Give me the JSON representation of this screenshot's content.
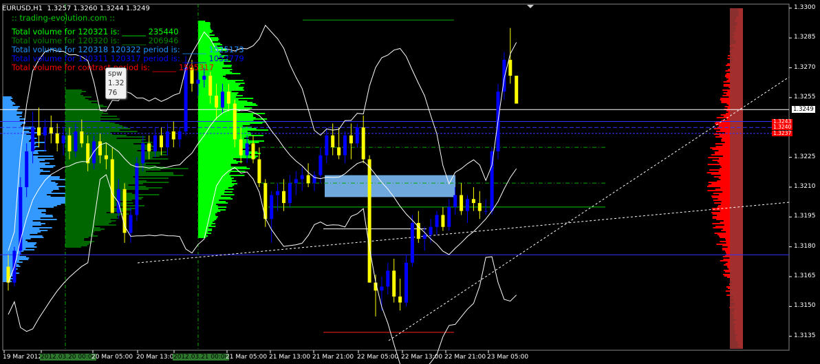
{
  "header": {
    "symbol": "EURUSD,H1",
    "ohlc": "1.3257 1.3260 1.3244 1.3249"
  },
  "site": ":: trading-evolution.com ::",
  "volume_lines": [
    {
      "text": "Total volume for 120321 is: ______ 235440",
      "color": "#00ff00"
    },
    {
      "text": "Total volume for 120320 is: ______ 206946",
      "color": "#008800"
    },
    {
      "text": "Total volume for 120318 120322 period is: ______ 1525173",
      "color": "#1e90ff"
    },
    {
      "text": "Total volume for 120311 120317 period is: ______ 1052779",
      "color": "#0000ff"
    },
    {
      "text": "Total volume for contract period is: ______ 1505317",
      "color": "#ff0000"
    }
  ],
  "tooltip": {
    "line1": "spw",
    "line2": "1.32",
    "line3": "76"
  },
  "price_axis": {
    "labels": [
      "1.3300",
      "1.3285",
      "1.3270",
      "1.3255",
      "1.3225",
      "1.3210",
      "1.3195",
      "1.3180",
      "1.3165",
      "1.3150",
      "1.3135"
    ],
    "values": [
      1.33,
      1.3285,
      1.327,
      1.3255,
      1.3225,
      1.321,
      1.3195,
      1.318,
      1.3165,
      1.315,
      1.3135
    ],
    "current_price": "1.3249",
    "current_value": 1.3249,
    "level_tags": [
      {
        "text": "1.3243",
        "value": 1.3243
      },
      {
        "text": "1.3240",
        "value": 1.324
      },
      {
        "text": "1.3237",
        "value": 1.3237
      }
    ]
  },
  "time_axis": {
    "labels": [
      {
        "text": "19 Mar 2012",
        "hl": false
      },
      {
        "text": "2012.03.20 00:00",
        "hl": true
      },
      {
        "text": "20 Mar 05:00",
        "hl": false
      },
      {
        "text": "20 Mar 13:00",
        "hl": false
      },
      {
        "text": "2012.03.21 00:00",
        "hl": true
      },
      {
        "text": "21 Mar 05:00",
        "hl": false
      },
      {
        "text": "21 Mar 13:00",
        "hl": false
      },
      {
        "text": "21 Mar 21:00",
        "hl": false
      },
      {
        "text": "22 Mar 05:00",
        "hl": false
      },
      {
        "text": "22 Mar 13:00",
        "hl": false
      },
      {
        "text": "22 Mar 21:00",
        "hl": false
      },
      {
        "text": "23 Mar 05:00",
        "hl": false
      }
    ]
  },
  "colors": {
    "bull": "#0000ff",
    "bear": "#ffff00",
    "bollinger": "#ffffff",
    "profile_green": "#00ff00",
    "profile_darkgreen": "#006600",
    "profile_lightblue": "#3399ff",
    "profile_red": "#ff0000",
    "profile_maroon": "#993333",
    "rect": "#6fa8dc"
  },
  "chart_data": {
    "type": "candlestick",
    "symbol": "EURUSD",
    "timeframe": "H1",
    "ylim": [
      1.3128,
      1.3302
    ],
    "candles": [
      [
        1.317,
        1.3176,
        1.3158,
        1.3162
      ],
      [
        1.3162,
        1.318,
        1.316,
        1.3178
      ],
      [
        1.3178,
        1.3215,
        1.3176,
        1.321
      ],
      [
        1.321,
        1.3232,
        1.3205,
        1.3228
      ],
      [
        1.3228,
        1.3248,
        1.3222,
        1.324
      ],
      [
        1.324,
        1.325,
        1.323,
        1.3236
      ],
      [
        1.3236,
        1.3244,
        1.3228,
        1.324
      ],
      [
        1.324,
        1.3246,
        1.3232,
        1.3237
      ],
      [
        1.3237,
        1.3242,
        1.3228,
        1.3232
      ],
      [
        1.3232,
        1.324,
        1.3226,
        1.3236
      ],
      [
        1.3236,
        1.324,
        1.3224,
        1.3228
      ],
      [
        1.3228,
        1.3242,
        1.3225,
        1.3238
      ],
      [
        1.3238,
        1.3244,
        1.323,
        1.3232
      ],
      [
        1.3232,
        1.3236,
        1.3218,
        1.3222
      ],
      [
        1.3222,
        1.3236,
        1.3219,
        1.3233
      ],
      [
        1.3233,
        1.3237,
        1.3222,
        1.3226
      ],
      [
        1.3226,
        1.3232,
        1.3219,
        1.3224
      ],
      [
        1.3224,
        1.323,
        1.32,
        1.3197
      ],
      [
        1.3197,
        1.3214,
        1.3194,
        1.3209
      ],
      [
        1.3209,
        1.3212,
        1.3182,
        1.3187
      ],
      [
        1.3187,
        1.32,
        1.3182,
        1.3196
      ],
      [
        1.3196,
        1.3225,
        1.3193,
        1.3222
      ],
      [
        1.3222,
        1.3236,
        1.3218,
        1.3232
      ],
      [
        1.3232,
        1.3236,
        1.3224,
        1.3228
      ],
      [
        1.3228,
        1.324,
        1.3225,
        1.3236
      ],
      [
        1.3236,
        1.324,
        1.3226,
        1.323
      ],
      [
        1.323,
        1.3242,
        1.3226,
        1.3238
      ],
      [
        1.3238,
        1.3243,
        1.323,
        1.3234
      ],
      [
        1.3234,
        1.324,
        1.323,
        1.3238
      ],
      [
        1.3238,
        1.3276,
        1.3236,
        1.327
      ],
      [
        1.327,
        1.3274,
        1.3258,
        1.3262
      ],
      [
        1.3262,
        1.3268,
        1.3256,
        1.3264
      ],
      [
        1.3264,
        1.327,
        1.326,
        1.3266
      ],
      [
        1.3266,
        1.3268,
        1.3252,
        1.3256
      ],
      [
        1.3256,
        1.3262,
        1.3244,
        1.325
      ],
      [
        1.325,
        1.3262,
        1.3247,
        1.3258
      ],
      [
        1.3258,
        1.3262,
        1.3248,
        1.3252
      ],
      [
        1.3252,
        1.3254,
        1.323,
        1.3234
      ],
      [
        1.3234,
        1.324,
        1.3222,
        1.3226
      ],
      [
        1.3226,
        1.3236,
        1.3222,
        1.3232
      ],
      [
        1.3232,
        1.3236,
        1.3222,
        1.3224
      ],
      [
        1.3224,
        1.323,
        1.321,
        1.3212
      ],
      [
        1.3212,
        1.3214,
        1.319,
        1.3194
      ],
      [
        1.3194,
        1.3208,
        1.3182,
        1.3206
      ],
      [
        1.3206,
        1.3212,
        1.3198,
        1.3208
      ],
      [
        1.3208,
        1.3214,
        1.3198,
        1.3202
      ],
      [
        1.3202,
        1.3216,
        1.32,
        1.3212
      ],
      [
        1.3212,
        1.3218,
        1.3206,
        1.3214
      ],
      [
        1.3214,
        1.322,
        1.3208,
        1.3216
      ],
      [
        1.3216,
        1.3222,
        1.321,
        1.3212
      ],
      [
        1.3212,
        1.3218,
        1.3208,
        1.3216
      ],
      [
        1.3216,
        1.323,
        1.3212,
        1.3226
      ],
      [
        1.3226,
        1.324,
        1.3222,
        1.3236
      ],
      [
        1.3236,
        1.3242,
        1.3226,
        1.323
      ],
      [
        1.323,
        1.324,
        1.3224,
        1.3226
      ],
      [
        1.3226,
        1.3238,
        1.3222,
        1.3236
      ],
      [
        1.3236,
        1.3242,
        1.3224,
        1.3232
      ],
      [
        1.3232,
        1.3242,
        1.323,
        1.324
      ],
      [
        1.324,
        1.3246,
        1.3222,
        1.3224
      ],
      [
        1.3224,
        1.3226,
        1.3172,
        1.3162
      ],
      [
        1.3162,
        1.3166,
        1.3145,
        1.3158
      ],
      [
        1.3158,
        1.3165,
        1.3148,
        1.316
      ],
      [
        1.316,
        1.3172,
        1.3156,
        1.3168
      ],
      [
        1.3168,
        1.3174,
        1.3152,
        1.3155
      ],
      [
        1.3155,
        1.3164,
        1.3148,
        1.3152
      ],
      [
        1.3152,
        1.3176,
        1.315,
        1.3172
      ],
      [
        1.3172,
        1.3196,
        1.317,
        1.3192
      ],
      [
        1.3192,
        1.3198,
        1.3182,
        1.3184
      ],
      [
        1.3184,
        1.319,
        1.3178,
        1.3186
      ],
      [
        1.3186,
        1.3194,
        1.3182,
        1.319
      ],
      [
        1.319,
        1.3198,
        1.3186,
        1.3196
      ],
      [
        1.3196,
        1.32,
        1.3188,
        1.319
      ],
      [
        1.319,
        1.3204,
        1.3188,
        1.32
      ],
      [
        1.32,
        1.321,
        1.3196,
        1.3206
      ],
      [
        1.3206,
        1.3212,
        1.3196,
        1.3198
      ],
      [
        1.3198,
        1.3206,
        1.3192,
        1.3204
      ],
      [
        1.3204,
        1.321,
        1.3198,
        1.3202
      ],
      [
        1.3202,
        1.3208,
        1.3194,
        1.3198
      ],
      [
        1.3198,
        1.3204,
        1.3196,
        1.3198
      ],
      [
        1.3198,
        1.323,
        1.3196,
        1.3228
      ],
      [
        1.3228,
        1.3262,
        1.3224,
        1.3258
      ],
      [
        1.3258,
        1.3278,
        1.3254,
        1.3274
      ],
      [
        1.3274,
        1.329,
        1.3262,
        1.3266
      ],
      [
        1.3266,
        1.3264,
        1.3252,
        1.3252
      ]
    ],
    "horizontal_levels": [
      1.3294,
      1.3249,
      1.3243,
      1.324,
      1.3237,
      1.323,
      1.3212,
      1.32,
      1.3189,
      1.3176,
      1.3137
    ]
  }
}
